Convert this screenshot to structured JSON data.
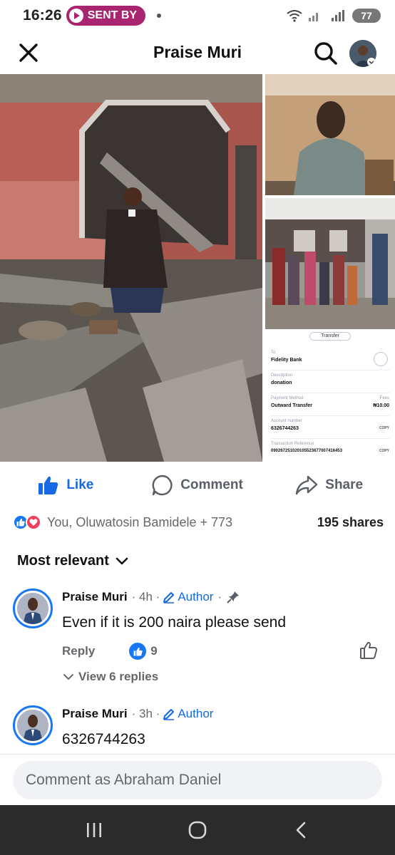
{
  "status_bar": {
    "time": "16:26",
    "sent_pill": "SENT BY",
    "battery": "77"
  },
  "header": {
    "title": "Praise Muri"
  },
  "receipt": {
    "pill": "Transfer",
    "to_label": "To",
    "to_value": "Fidelity Bank",
    "description_label": "Description",
    "description_value": "donation",
    "method_label": "Payment Method",
    "method_value": "Outward Transfer",
    "fees_label": "Fees",
    "fees_value": "₦10.00",
    "account_label": "Account number",
    "account_value": "6326744263",
    "copy1": "COPY",
    "reference_label": "Transaction Reference",
    "reference_value": "090267251020105523677007416453",
    "copy2": "COPY"
  },
  "actions": {
    "like": "Like",
    "comment": "Comment",
    "share": "Share"
  },
  "reactions": {
    "text": "You, Oluwatosin Bamidele + 773",
    "shares": "195 shares"
  },
  "sort": {
    "label": "Most relevant"
  },
  "comments": [
    {
      "name": "Praise Muri",
      "time": "· 4h ·",
      "badge": "Author",
      "text": "Even if it is 200 naira please send",
      "reply": "Reply",
      "likes": "9",
      "view_replies": "View 6 replies"
    },
    {
      "name": "Praise Muri",
      "time": "· 3h ·",
      "badge": "Author",
      "text": "6326744263"
    }
  ],
  "input": {
    "placeholder": "Comment as Abraham Daniel"
  },
  "colors": {
    "brand_blue": "#1877f2",
    "pill_magenta": "#a8256f",
    "love_red": "#f33e58"
  }
}
